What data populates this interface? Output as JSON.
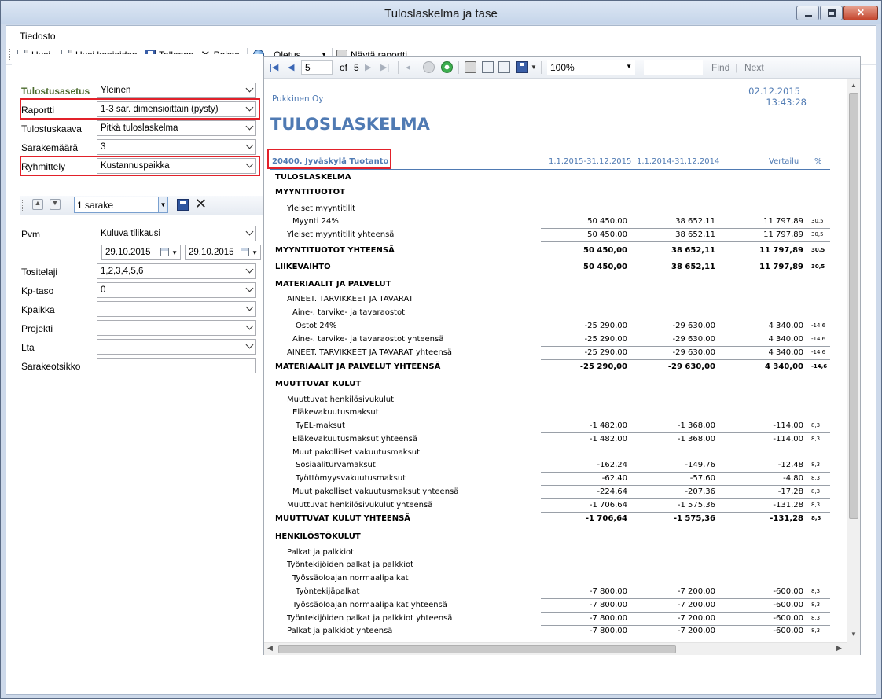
{
  "window": {
    "title": "Tuloslaskelma ja tase"
  },
  "menu": {
    "file": "Tiedosto"
  },
  "toolbar": {
    "new": "Uusi",
    "new_copy": "Uusi kopioiden",
    "save": "Tallenna",
    "delete": "Poista",
    "profile": "Oletus",
    "show_report": "Näytä raportti"
  },
  "form": {
    "print_setting_label": "Tulostusasetus",
    "print_setting_value": "Yleinen",
    "report_label": "Raportti",
    "report_value": "1-3 sar. dimensioittain (pysty)",
    "layout_label": "Tulostuskaava",
    "layout_value": "Pitkä tuloslaskelma",
    "columns_label": "Sarakemäärä",
    "columns_value": "3",
    "grouping_label": "Ryhmittely",
    "grouping_value": "Kustannuspaikka",
    "column_selector": "1 sarake",
    "date_label": "Pvm",
    "date_value": "Kuluva tilikausi",
    "date_from": "29.10.2015",
    "date_to": "29.10.2015",
    "voucher_type_label": "Tositelaji",
    "voucher_type_value": "1,2,3,4,5,6",
    "cc_level_label": "Kp-taso",
    "cc_level_value": "0",
    "cost_center_label": "Kpaikka",
    "cost_center_value": "",
    "project_label": "Projekti",
    "project_value": "",
    "lta_label": "Lta",
    "lta_value": "",
    "column_title_label": "Sarakeotsikko",
    "column_title_value": ""
  },
  "viewer": {
    "page": "5",
    "of_label": "of",
    "total_pages": "5",
    "zoom": "100%",
    "find": "Find",
    "next": "Next"
  },
  "report": {
    "company": "Pukkinen Oy",
    "date": "02.12.2015",
    "time": "13:43:28",
    "title": "TULOSLASKELMA",
    "dimension": "20400. Jyväskylä Tuotanto",
    "col1": "1.1.2015-31.12.2015",
    "col2": "1.1.2014-31.12.2014",
    "col3": "Vertailu",
    "col4": "%",
    "rows": [
      {
        "label": "TULOSLASKELMA",
        "indent": 0,
        "bold": true,
        "v1": "",
        "v2": "",
        "v3": "",
        "p": ""
      },
      {
        "label": "MYYNTITUOTOT",
        "indent": 0,
        "bold": true,
        "v1": "",
        "v2": "",
        "v3": "",
        "p": ""
      },
      {
        "label": "Yleiset myyntitilit",
        "indent": 1,
        "bold": false,
        "v1": "",
        "v2": "",
        "v3": "",
        "p": ""
      },
      {
        "label": "Myynti 24%",
        "indent": 2,
        "bold": false,
        "v1": "50 450,00",
        "v2": "38 652,11",
        "v3": "11 797,89",
        "p": "30,5"
      },
      {
        "label": "Yleiset myyntitilit yhteensä",
        "indent": 1,
        "bold": false,
        "v1": "50 450,00",
        "v2": "38 652,11",
        "v3": "11 797,89",
        "p": "30,5"
      },
      {
        "label": "MYYNTITUOTOT YHTEENSÄ",
        "indent": 0,
        "bold": true,
        "v1": "50 450,00",
        "v2": "38 652,11",
        "v3": "11 797,89",
        "p": "30,5"
      },
      {
        "label": "LIIKEVAIHTO",
        "indent": 0,
        "bold": true,
        "v1": "50 450,00",
        "v2": "38 652,11",
        "v3": "11 797,89",
        "p": "30,5"
      },
      {
        "label": "MATERIAALIT JA PALVELUT",
        "indent": 0,
        "bold": true,
        "v1": "",
        "v2": "",
        "v3": "",
        "p": ""
      },
      {
        "label": "AINEET. TARVIKKEET JA TAVARAT",
        "indent": 1,
        "bold": false,
        "v1": "",
        "v2": "",
        "v3": "",
        "p": ""
      },
      {
        "label": "Aine-. tarvike- ja tavaraostot",
        "indent": 2,
        "bold": false,
        "v1": "",
        "v2": "",
        "v3": "",
        "p": ""
      },
      {
        "label": "Ostot 24%",
        "indent": 3,
        "bold": false,
        "v1": "-25 290,00",
        "v2": "-29 630,00",
        "v3": "4 340,00",
        "p": "-14,6"
      },
      {
        "label": "Aine-. tarvike- ja tavaraostot yhteensä",
        "indent": 2,
        "bold": false,
        "v1": "-25 290,00",
        "v2": "-29 630,00",
        "v3": "4 340,00",
        "p": "-14,6"
      },
      {
        "label": "AINEET. TARVIKKEET JA TAVARAT yhteensä",
        "indent": 1,
        "bold": false,
        "v1": "-25 290,00",
        "v2": "-29 630,00",
        "v3": "4 340,00",
        "p": "-14,6"
      },
      {
        "label": "MATERIAALIT JA PALVELUT YHTEENSÄ",
        "indent": 0,
        "bold": true,
        "v1": "-25 290,00",
        "v2": "-29 630,00",
        "v3": "4 340,00",
        "p": "-14,6"
      },
      {
        "label": "MUUTTUVAT KULUT",
        "indent": 0,
        "bold": true,
        "v1": "",
        "v2": "",
        "v3": "",
        "p": ""
      },
      {
        "label": "Muuttuvat henkilösivukulut",
        "indent": 1,
        "bold": false,
        "v1": "",
        "v2": "",
        "v3": "",
        "p": ""
      },
      {
        "label": "Eläkevakuutusmaksut",
        "indent": 2,
        "bold": false,
        "v1": "",
        "v2": "",
        "v3": "",
        "p": ""
      },
      {
        "label": "TyEL-maksut",
        "indent": 3,
        "bold": false,
        "v1": "-1 482,00",
        "v2": "-1 368,00",
        "v3": "-114,00",
        "p": "8,3"
      },
      {
        "label": "Eläkevakuutusmaksut yhteensä",
        "indent": 2,
        "bold": false,
        "v1": "-1 482,00",
        "v2": "-1 368,00",
        "v3": "-114,00",
        "p": "8,3"
      },
      {
        "label": "Muut pakolliset vakuutusmaksut",
        "indent": 2,
        "bold": false,
        "v1": "",
        "v2": "",
        "v3": "",
        "p": ""
      },
      {
        "label": "Sosiaaliturvamaksut",
        "indent": 3,
        "bold": false,
        "v1": "-162,24",
        "v2": "-149,76",
        "v3": "-12,48",
        "p": "8,3"
      },
      {
        "label": "Työttömyysvakuutusmaksut",
        "indent": 3,
        "bold": false,
        "v1": "-62,40",
        "v2": "-57,60",
        "v3": "-4,80",
        "p": "8,3"
      },
      {
        "label": "Muut pakolliset vakuutusmaksut yhteensä",
        "indent": 2,
        "bold": false,
        "v1": "-224,64",
        "v2": "-207,36",
        "v3": "-17,28",
        "p": "8,3"
      },
      {
        "label": "Muuttuvat henkilösivukulut yhteensä",
        "indent": 1,
        "bold": false,
        "v1": "-1 706,64",
        "v2": "-1 575,36",
        "v3": "-131,28",
        "p": "8,3"
      },
      {
        "label": "MUUTTUVAT KULUT YHTEENSÄ",
        "indent": 0,
        "bold": true,
        "v1": "-1 706,64",
        "v2": "-1 575,36",
        "v3": "-131,28",
        "p": "8,3"
      },
      {
        "label": "HENKILÖSTÖKULUT",
        "indent": 0,
        "bold": true,
        "v1": "",
        "v2": "",
        "v3": "",
        "p": ""
      },
      {
        "label": "Palkat ja palkkiot",
        "indent": 1,
        "bold": false,
        "v1": "",
        "v2": "",
        "v3": "",
        "p": ""
      },
      {
        "label": "Työntekijöiden palkat ja palkkiot",
        "indent": 1,
        "bold": false,
        "v1": "",
        "v2": "",
        "v3": "",
        "p": ""
      },
      {
        "label": "Työssäoloajan normaalipalkat",
        "indent": 2,
        "bold": false,
        "v1": "",
        "v2": "",
        "v3": "",
        "p": ""
      },
      {
        "label": "Työntekijäpalkat",
        "indent": 3,
        "bold": false,
        "v1": "-7 800,00",
        "v2": "-7 200,00",
        "v3": "-600,00",
        "p": "8,3"
      },
      {
        "label": "Työssäoloajan normaalipalkat yhteensä",
        "indent": 2,
        "bold": false,
        "v1": "-7 800,00",
        "v2": "-7 200,00",
        "v3": "-600,00",
        "p": "8,3"
      },
      {
        "label": "Työntekijöiden palkat ja palkkiot yhteensä",
        "indent": 1,
        "bold": false,
        "v1": "-7 800,00",
        "v2": "-7 200,00",
        "v3": "-600,00",
        "p": "8,3"
      },
      {
        "label": "Palkat ja palkkiot yhteensä",
        "indent": 1,
        "bold": false,
        "v1": "-7 800,00",
        "v2": "-7 200,00",
        "v3": "-600,00",
        "p": "8,3"
      }
    ]
  }
}
